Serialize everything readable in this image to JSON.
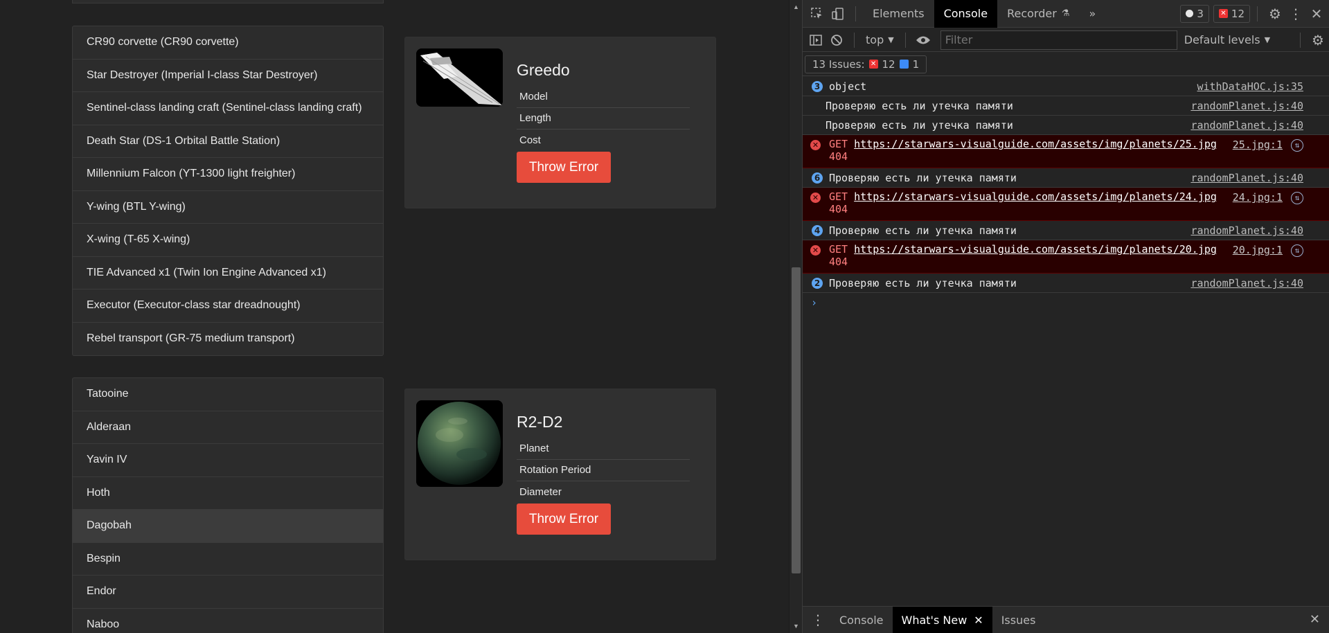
{
  "app": {
    "starships": [
      "CR90 corvette (CR90 corvette)",
      "Star Destroyer (Imperial I-class Star Destroyer)",
      "Sentinel-class landing craft (Sentinel-class landing craft)",
      "Death Star (DS-1 Orbital Battle Station)",
      "Millennium Falcon (YT-1300 light freighter)",
      "Y-wing (BTL Y-wing)",
      "X-wing (T-65 X-wing)",
      "TIE Advanced x1 (Twin Ion Engine Advanced x1)",
      "Executor (Executor-class star dreadnought)",
      "Rebel transport (GR-75 medium transport)"
    ],
    "ship_card": {
      "name": "Greedo",
      "details": [
        "Model",
        "Length",
        "Cost"
      ],
      "button": "Throw Error"
    },
    "planets": [
      "Tatooine",
      "Alderaan",
      "Yavin IV",
      "Hoth",
      "Dagobah",
      "Bespin",
      "Endor",
      "Naboo"
    ],
    "planets_active": "Dagobah",
    "planet_card": {
      "name": "R2-D2",
      "details": [
        "Planet",
        "Rotation Period",
        "Diameter"
      ],
      "button": "Throw Error"
    }
  },
  "devtools": {
    "tabs": [
      "Elements",
      "Console",
      "Recorder",
      "»"
    ],
    "active_tab": "Console",
    "badge_info": "3",
    "badge_errors": "12",
    "context": "top",
    "filter_placeholder": "Filter",
    "levels": "Default levels",
    "issues_label": "13 Issues:",
    "issues_errors": "12",
    "issues_info": "1",
    "messages": [
      {
        "kind": "normal",
        "count": "3",
        "text": "object",
        "src": "withDataHOC.js:35"
      },
      {
        "kind": "normal",
        "count": "",
        "text": "Проверяю есть ли утечка памяти",
        "src": "randomPlanet.js:40"
      },
      {
        "kind": "normal",
        "count": "",
        "text": "Проверяю есть ли утечка памяти",
        "src": "randomPlanet.js:40"
      },
      {
        "kind": "error",
        "method": "GET",
        "url": "https://starwars-visualguide.com/assets/img/planets/25.jpg",
        "status": "404",
        "src": "25.jpg:1"
      },
      {
        "kind": "normal",
        "count": "6",
        "text": "Проверяю есть ли утечка памяти",
        "src": "randomPlanet.js:40"
      },
      {
        "kind": "error",
        "method": "GET",
        "url": "https://starwars-visualguide.com/assets/img/planets/24.jpg",
        "status": "404",
        "src": "24.jpg:1"
      },
      {
        "kind": "normal",
        "count": "4",
        "text": "Проверяю есть ли утечка памяти",
        "src": "randomPlanet.js:40"
      },
      {
        "kind": "error",
        "method": "GET",
        "url": "https://starwars-visualguide.com/assets/img/planets/20.jpg",
        "status": "404",
        "src": "20.jpg:1"
      },
      {
        "kind": "normal",
        "count": "2",
        "text": "Проверяю есть ли утечка памяти",
        "src": "randomPlanet.js:40"
      }
    ],
    "prompt": "›",
    "drawer_tabs": [
      "Console",
      "What's New",
      "Issues"
    ],
    "drawer_active": "What's New"
  }
}
